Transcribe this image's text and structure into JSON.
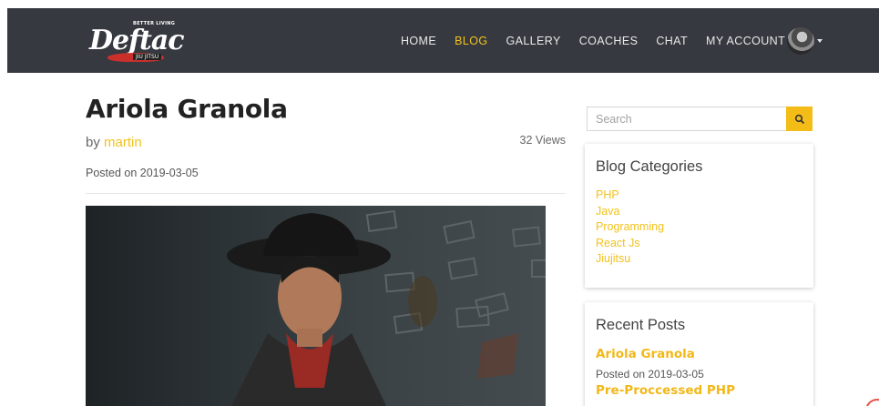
{
  "header": {
    "logo": {
      "text": "Deftac",
      "tagline": "BETTER LIVING",
      "sub": "JIU JITSU"
    },
    "nav": [
      {
        "label": "HOME"
      },
      {
        "label": "BLOG",
        "active": true
      },
      {
        "label": "GALLERY"
      },
      {
        "label": "COACHES"
      },
      {
        "label": "CHAT"
      }
    ],
    "account_label": "MY ACCOUNT"
  },
  "post": {
    "title": "Ariola Granola",
    "by_prefix": "by",
    "author": "martin",
    "views": "32 Views",
    "posted": "Posted on 2019-03-05"
  },
  "sidebar": {
    "search": {
      "placeholder": "Search",
      "value": ""
    },
    "categories": {
      "title": "Blog Categories",
      "items": [
        "PHP",
        "Java",
        "Programming",
        "React Js",
        "Jiujitsu"
      ]
    },
    "recent": {
      "title": "Recent Posts",
      "items": [
        {
          "title": "Ariola Granola",
          "date": "Posted on 2019-03-05"
        },
        {
          "title": "Pre-Proccessed PHP"
        }
      ]
    }
  },
  "colors": {
    "accent": "#f2c21c",
    "navbar": "#36393f",
    "search_button": "#f4bc17"
  },
  "icons": {
    "search_button": "search-icon",
    "account_caret": "chevron-down-icon"
  }
}
